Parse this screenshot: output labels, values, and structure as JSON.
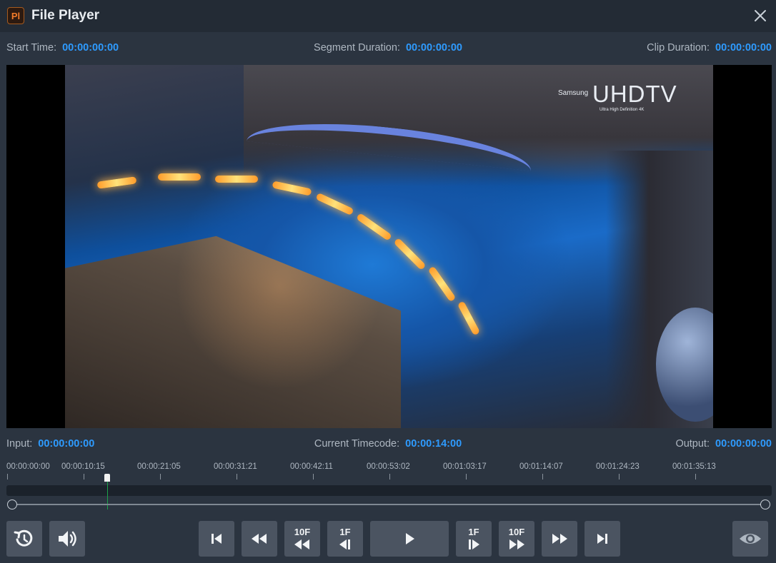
{
  "window": {
    "title": "File Player",
    "app_icon_text": "Pl"
  },
  "info_top": {
    "start_time_label": "Start Time:",
    "start_time_value": "00:00:00:00",
    "segment_duration_label": "Segment Duration:",
    "segment_duration_value": "00:00:00:00",
    "clip_duration_label": "Clip Duration:",
    "clip_duration_value": "00:00:00:00"
  },
  "video": {
    "watermark_small": "Samsung",
    "watermark_big": "UHDTV",
    "watermark_sub": "Ultra High Definition 4K"
  },
  "info_bottom": {
    "input_label": "Input:",
    "input_value": "00:00:00:00",
    "current_timecode_label": "Current Timecode:",
    "current_timecode_value": "00:00:14:00",
    "output_label": "Output:",
    "output_value": "00:00:00:00"
  },
  "timeline": {
    "ticks": [
      "00:00:00:00",
      "00:00:10:15",
      "00:00:21:05",
      "00:00:31:21",
      "00:00:42:11",
      "00:00:53:02",
      "00:01:03:17",
      "00:01:14:07",
      "00:01:24:23",
      "00:01:35:13"
    ]
  },
  "controls": {
    "step_back_10_caption": "10F",
    "step_back_1_caption": "1F",
    "step_fwd_1_caption": "1F",
    "step_fwd_10_caption": "10F"
  },
  "colors": {
    "accent": "#2e9bff",
    "button": "#4b5461",
    "playhead_line": "#1ca34a"
  }
}
